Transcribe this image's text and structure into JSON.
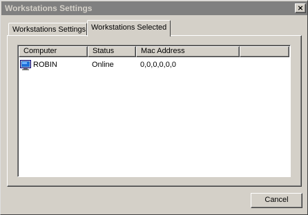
{
  "window": {
    "title": "Workstations Settings",
    "close_glyph": "×"
  },
  "tabs": [
    {
      "label": "Workstations Settings",
      "selected": false
    },
    {
      "label": "Workstations Selected",
      "selected": true
    }
  ],
  "list": {
    "columns": [
      "Computer",
      "Status",
      "Mac Address"
    ],
    "rows": [
      {
        "icon": "computer-icon",
        "computer": "ROBIN",
        "status": "Online",
        "mac": "0,0,0,0,0,0"
      }
    ]
  },
  "buttons": {
    "cancel_label": "Cancel"
  }
}
